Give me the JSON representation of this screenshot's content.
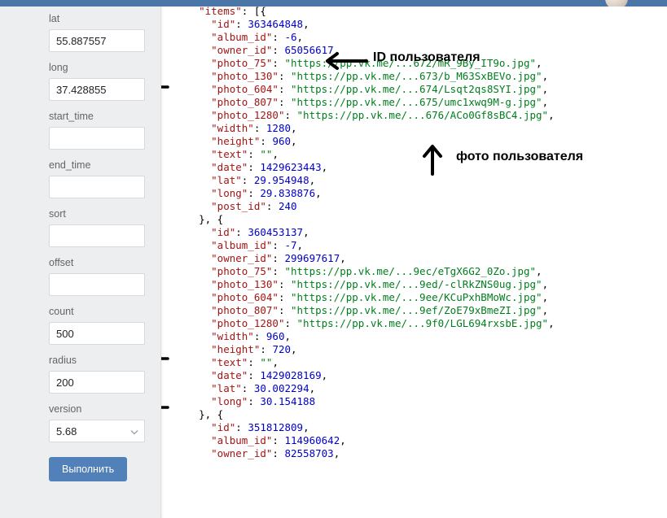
{
  "sidebar": {
    "fields": {
      "lat": {
        "label": "lat",
        "value": "55.887557"
      },
      "long": {
        "label": "long",
        "value": "37.428855"
      },
      "start_time": {
        "label": "start_time",
        "value": ""
      },
      "end_time": {
        "label": "end_time",
        "value": ""
      },
      "sort": {
        "label": "sort",
        "value": ""
      },
      "offset": {
        "label": "offset",
        "value": ""
      },
      "count": {
        "label": "count",
        "value": "500"
      },
      "radius": {
        "label": "radius",
        "value": "200"
      },
      "version": {
        "label": "version",
        "value": "5.68"
      }
    },
    "run_button": "Выполнить"
  },
  "annotations": {
    "owner_id_label": "ID пользователя",
    "photo_label": "фото пользователя"
  },
  "response": {
    "items_label": "\"items\"",
    "items_open": ": [{",
    "rows": [
      {
        "indent": 3,
        "key": "\"id\"",
        "val": "363464848",
        "type": "n",
        "trail": ","
      },
      {
        "indent": 3,
        "key": "\"album_id\"",
        "val": "-6",
        "type": "n",
        "trail": ","
      },
      {
        "indent": 3,
        "key": "\"owner_id\"",
        "val": "65056617",
        "type": "n",
        "trail": ","
      },
      {
        "indent": 3,
        "key": "\"photo_75\"",
        "val": "\"https://pp.vk.me/...672/mR_9By_IT9o.jpg\"",
        "type": "s",
        "trail": ","
      },
      {
        "indent": 3,
        "key": "\"photo_130\"",
        "val": "\"https://pp.vk.me/...673/b_M63SxBEVo.jpg\"",
        "type": "s",
        "trail": ","
      },
      {
        "indent": 3,
        "key": "\"photo_604\"",
        "val": "\"https://pp.vk.me/...674/Lsqt2qs8SYI.jpg\"",
        "type": "s",
        "trail": ","
      },
      {
        "indent": 3,
        "key": "\"photo_807\"",
        "val": "\"https://pp.vk.me/...675/umc1xwq9M-g.jpg\"",
        "type": "s",
        "trail": ","
      },
      {
        "indent": 3,
        "key": "\"photo_1280\"",
        "val": "\"https://pp.vk.me/...676/ACo0Gf8sBC4.jpg\"",
        "type": "s",
        "trail": ","
      },
      {
        "indent": 3,
        "key": "\"width\"",
        "val": "1280",
        "type": "n",
        "trail": ","
      },
      {
        "indent": 3,
        "key": "\"height\"",
        "val": "960",
        "type": "n",
        "trail": ","
      },
      {
        "indent": 3,
        "key": "\"text\"",
        "val": "\"\"",
        "type": "s",
        "trail": ","
      },
      {
        "indent": 3,
        "key": "\"date\"",
        "val": "1429623443",
        "type": "n",
        "trail": ","
      },
      {
        "indent": 3,
        "key": "\"lat\"",
        "val": "29.954948",
        "type": "n",
        "trail": ","
      },
      {
        "indent": 3,
        "key": "\"long\"",
        "val": "29.838876",
        "type": "n",
        "trail": ","
      },
      {
        "indent": 3,
        "key": "\"post_id\"",
        "val": "240",
        "type": "n",
        "trail": ""
      },
      {
        "indent": 2,
        "key": "",
        "val": "}, {",
        "type": "p",
        "trail": ""
      },
      {
        "indent": 3,
        "key": "\"id\"",
        "val": "360453137",
        "type": "n",
        "trail": ","
      },
      {
        "indent": 3,
        "key": "\"album_id\"",
        "val": "-7",
        "type": "n",
        "trail": ","
      },
      {
        "indent": 3,
        "key": "\"owner_id\"",
        "val": "299697617",
        "type": "n",
        "trail": ","
      },
      {
        "indent": 3,
        "key": "\"photo_75\"",
        "val": "\"https://pp.vk.me/...9ec/eTgX6G2_0Zo.jpg\"",
        "type": "s",
        "trail": ","
      },
      {
        "indent": 3,
        "key": "\"photo_130\"",
        "val": "\"https://pp.vk.me/...9ed/-clRkZNS0ug.jpg\"",
        "type": "s",
        "trail": ","
      },
      {
        "indent": 3,
        "key": "\"photo_604\"",
        "val": "\"https://pp.vk.me/...9ee/KCuPxhBMoWc.jpg\"",
        "type": "s",
        "trail": ","
      },
      {
        "indent": 3,
        "key": "\"photo_807\"",
        "val": "\"https://pp.vk.me/...9ef/ZoE79xBmeZI.jpg\"",
        "type": "s",
        "trail": ","
      },
      {
        "indent": 3,
        "key": "\"photo_1280\"",
        "val": "\"https://pp.vk.me/...9f0/LGL694rxsbE.jpg\"",
        "type": "s",
        "trail": ","
      },
      {
        "indent": 3,
        "key": "\"width\"",
        "val": "960",
        "type": "n",
        "trail": ","
      },
      {
        "indent": 3,
        "key": "\"height\"",
        "val": "720",
        "type": "n",
        "trail": ","
      },
      {
        "indent": 3,
        "key": "\"text\"",
        "val": "\"\"",
        "type": "s",
        "trail": ","
      },
      {
        "indent": 3,
        "key": "\"date\"",
        "val": "1429028169",
        "type": "n",
        "trail": ","
      },
      {
        "indent": 3,
        "key": "\"lat\"",
        "val": "30.002294",
        "type": "n",
        "trail": ","
      },
      {
        "indent": 3,
        "key": "\"long\"",
        "val": "30.154188",
        "type": "n",
        "trail": ""
      },
      {
        "indent": 2,
        "key": "",
        "val": "}, {",
        "type": "p",
        "trail": ""
      },
      {
        "indent": 3,
        "key": "\"id\"",
        "val": "351812809",
        "type": "n",
        "trail": ","
      },
      {
        "indent": 3,
        "key": "\"album_id\"",
        "val": "114960642",
        "type": "n",
        "trail": ","
      },
      {
        "indent": 3,
        "key": "\"owner_id\"",
        "val": "82558703",
        "type": "n",
        "trail": ","
      }
    ]
  }
}
